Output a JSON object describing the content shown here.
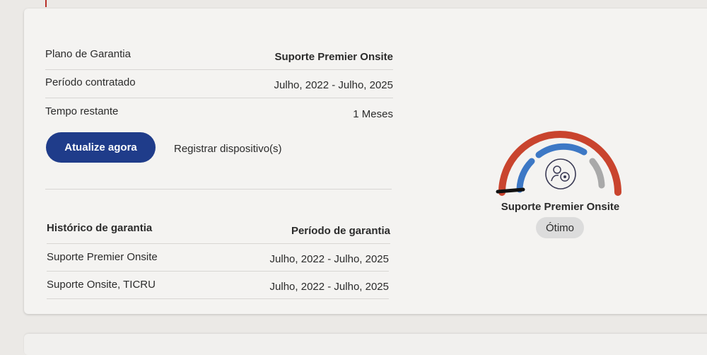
{
  "coverage": {
    "rows": [
      {
        "label": "Plano de Garantia",
        "value": "Suporte Premier Onsite"
      },
      {
        "label": "Período contratado",
        "value": "Julho, 2022 - Julho, 2025"
      },
      {
        "label": "Tempo restante",
        "value": "1 Meses"
      }
    ],
    "renew_button": "Atualize agora",
    "register_link": "Registrar dispositivo(s)"
  },
  "history": {
    "col_plan": "Histórico de garantia",
    "col_period": "Período de garantia",
    "rows": [
      {
        "plan": "Suporte Premier Onsite",
        "period": "Julho, 2022 - Julho, 2025"
      },
      {
        "plan": "Suporte Onsite, TICRU",
        "period": "Julho, 2022 - Julho, 2025"
      }
    ]
  },
  "gauge": {
    "title": "Suporte Premier Onsite",
    "status": "Ótimo",
    "icon": "support-agent-gear-icon",
    "colors": {
      "outer": "#c9442e",
      "inner": "#3d78c5",
      "gray": "#a9a9a9",
      "needle": "#111111"
    }
  }
}
